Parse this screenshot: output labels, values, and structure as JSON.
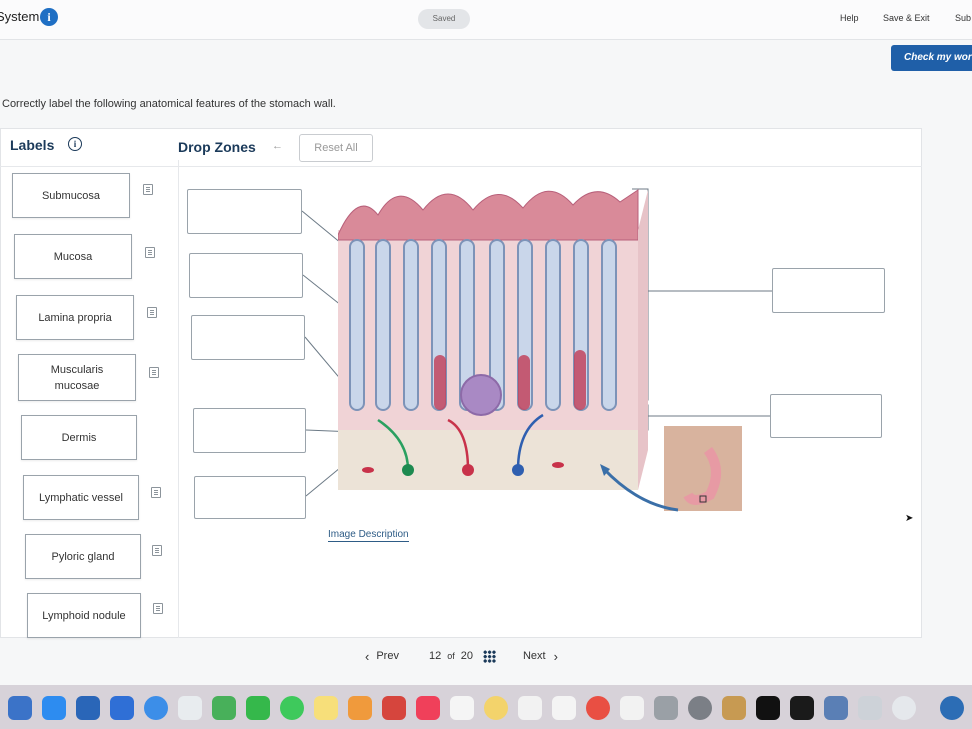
{
  "header": {
    "system_title": "System",
    "saved_label": "Saved",
    "help_label": "Help",
    "save_exit_label": "Save & Exit",
    "submit_label": "Sub",
    "check_work_label": "Check my wor"
  },
  "question": "Correctly label the following anatomical features of the stomach wall.",
  "labels_panel": {
    "title": "Labels",
    "items": [
      {
        "label": "Submucosa"
      },
      {
        "label": "Mucosa"
      },
      {
        "label": "Lamina propria"
      },
      {
        "label": "Muscularis mucosae"
      },
      {
        "label": "Dermis"
      },
      {
        "label": "Lymphatic vessel"
      },
      {
        "label": "Pyloric gland"
      },
      {
        "label": "Lymphoid nodule"
      }
    ]
  },
  "drop_zones_panel": {
    "title": "Drop Zones",
    "reset_label": "Reset All",
    "image_description_link": "Image Description"
  },
  "pager": {
    "prev_label": "Prev",
    "current": "12",
    "of_label": "of",
    "total": "20",
    "next_label": "Next"
  },
  "colors": {
    "accent": "#1f5fa8",
    "title": "#1b3a5a",
    "link": "#2e5c86",
    "card_border": "#9aa3ab"
  },
  "icons": [
    "info-icon",
    "back-arrow-icon",
    "note-icon",
    "chevron-left-icon",
    "grid-icon",
    "chevron-right-icon"
  ]
}
